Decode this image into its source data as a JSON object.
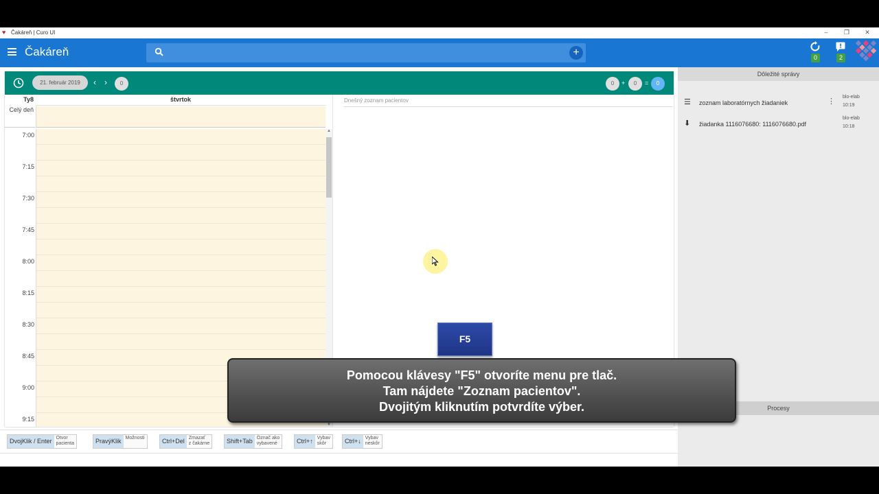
{
  "window": {
    "title": "Čakáreň | Curo UI",
    "controls": [
      "–",
      "❐",
      "✕"
    ]
  },
  "appbar": {
    "title": "Čakáreň",
    "search_placeholder": "",
    "sync_badge": "0",
    "messages_badge": "2"
  },
  "calendar": {
    "date": "21. február 2019",
    "count": "0",
    "week": "Ty8",
    "day": "štvrtok",
    "allday": "Celý deň",
    "times": [
      "7:00",
      "7:15",
      "7:30",
      "7:45",
      "8:00",
      "8:15",
      "8:30",
      "8:45",
      "9:00",
      "9:15"
    ],
    "totals": [
      "0",
      "+",
      "0",
      "=",
      "0"
    ]
  },
  "patients": {
    "header": "Dnešný zoznam pacientov"
  },
  "right_panel": {
    "header": "Dôležité správy",
    "messages": [
      {
        "icon": "list-icon",
        "text": "zoznam laboratórnych žiadaniek",
        "user": "blo-elab",
        "time": "10:19"
      },
      {
        "icon": "download-icon",
        "text": "žiadanka 1116076680: 1116076680.pdf",
        "user": "blo-elab",
        "time": "10:18"
      }
    ],
    "processes": "Procesy"
  },
  "shortcuts": [
    {
      "key": "DvojKlik / Enter",
      "desc1": "Otvor",
      "desc2": "pacienta"
    },
    {
      "key": "PravýKlik",
      "desc1": "Možnosti",
      "desc2": ""
    },
    {
      "key": "Ctrl+Del",
      "desc1": "Zmazať",
      "desc2": "z čakárne"
    },
    {
      "key": "Shift+Tab",
      "desc1": "Označ ako",
      "desc2": "vybavené"
    },
    {
      "key": "Ctrl+↑",
      "desc1": "Vybav",
      "desc2": "skôr"
    },
    {
      "key": "Ctrl+↓",
      "desc1": "Vybav",
      "desc2": "neskôr"
    }
  ],
  "overlay": {
    "key": "F5",
    "lines": [
      "Pomocou klávesy \"F5\" otvoríte menu pre tlač.",
      "Tam nájdete \"Zoznam pacientov\".",
      "Dvojitým kliknutím potvrdíte výber."
    ]
  },
  "colors": {
    "appbar": "#1976d2",
    "card_header": "#00897b",
    "slot_bg": "#fdf5e0",
    "badge": "#43a047"
  }
}
